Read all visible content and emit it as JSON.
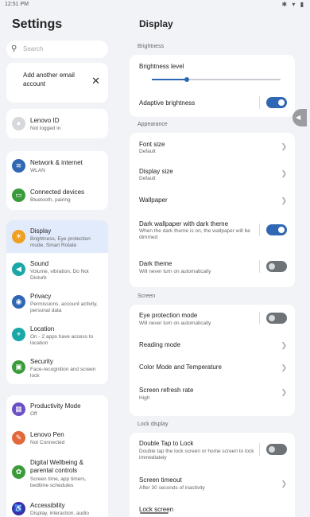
{
  "status_bar": {
    "time": "12:51 PM",
    "icons": "✱ ▾ ▮"
  },
  "left": {
    "title": "Settings",
    "search_placeholder": "Search",
    "add_account": {
      "label": "Add another email account"
    },
    "lenovo_id": {
      "title": "Lenovo ID",
      "subtitle": "Not logged in"
    },
    "items": [
      {
        "title": "Network & internet",
        "subtitle": "WLAN",
        "color": "#2f67b4",
        "icon": "wifi-icon"
      },
      {
        "title": "Connected devices",
        "subtitle": "Bluetooth, pairing",
        "color": "#3a9b3a",
        "icon": "devices-icon"
      },
      {
        "title": "Display",
        "subtitle": "Brightness, Eye protection mode, Smart Rotate",
        "color": "#f0a020",
        "icon": "display-icon"
      },
      {
        "title": "Sound",
        "subtitle": "Volume, vibration, Do Not Disturb",
        "color": "#1aa7a7",
        "icon": "sound-icon"
      },
      {
        "title": "Privacy",
        "subtitle": "Permissions, account activity, personal data",
        "color": "#2f67b4",
        "icon": "privacy-icon"
      },
      {
        "title": "Location",
        "subtitle": "On - 2 apps have access to location",
        "color": "#1aa7a7",
        "icon": "location-icon"
      },
      {
        "title": "Security",
        "subtitle": "Face-recognition and screen lock",
        "color": "#3a9b3a",
        "icon": "lock-icon"
      },
      {
        "title": "Productivity Mode",
        "subtitle": "Off",
        "color": "#6a4fc7",
        "icon": "productivity-icon"
      },
      {
        "title": "Lenovo Pen",
        "subtitle": "Not Connected",
        "color": "#e06a3a",
        "icon": "pen-icon"
      },
      {
        "title": "Digital Wellbeing & parental controls",
        "subtitle": "Screen time, app timers, bedtime schedules",
        "color": "#3a9b3a",
        "icon": "wellbeing-icon"
      },
      {
        "title": "Accessibility",
        "subtitle": "Display, interaction, audio",
        "color": "#3b2fa8",
        "icon": "accessibility-icon"
      }
    ]
  },
  "right": {
    "title": "Display",
    "sections": {
      "brightness": "Brightness",
      "appearance": "Appearance",
      "screen": "Screen",
      "lock": "Lock display"
    },
    "brightness_level": {
      "title": "Brightness level",
      "value": 0.27
    },
    "adaptive": {
      "title": "Adaptive brightness",
      "on": true
    },
    "font_size": {
      "title": "Font size",
      "subtitle": "Default"
    },
    "display_size": {
      "title": "Display size",
      "subtitle": "Default"
    },
    "wallpaper": {
      "title": "Wallpaper"
    },
    "dark_wallpaper": {
      "title": "Dark wallpaper with dark theme",
      "subtitle": "When the dark theme is on, the wallpaper will be dimmed",
      "on": true
    },
    "dark_theme": {
      "title": "Dark theme",
      "subtitle": "Will never turn on automatically",
      "on": false
    },
    "eye_protection": {
      "title": "Eye protection mode",
      "subtitle": "Will never turn on automatically",
      "on": false
    },
    "reading_mode": {
      "title": "Reading mode"
    },
    "color_mode": {
      "title": "Color Mode and Temperature"
    },
    "refresh_rate": {
      "title": "Screen refresh rate",
      "subtitle": "High"
    },
    "double_tap": {
      "title": "Double Tap to Lock",
      "subtitle": "Double tap the lock screen or home screen to lock immediately",
      "on": false
    },
    "timeout": {
      "title": "Screen timeout",
      "subtitle": "After 30 seconds of inactivity"
    },
    "lock_screen": {
      "title": "Lock screen"
    }
  }
}
